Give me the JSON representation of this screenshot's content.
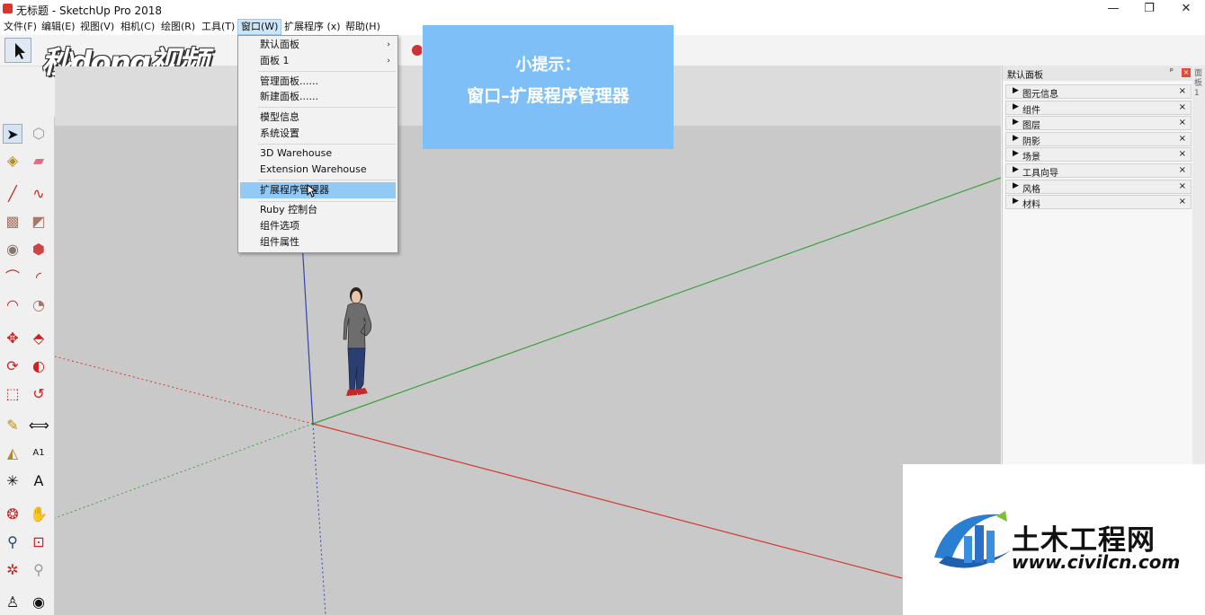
{
  "window": {
    "title": "无标题 - SketchUp Pro 2018",
    "controls": [
      "minimize-icon",
      "restore-icon",
      "close-icon"
    ]
  },
  "menubar": [
    {
      "label": "文件(F)"
    },
    {
      "label": "编辑(E)"
    },
    {
      "label": "视图(V)"
    },
    {
      "label": "相机(C)"
    },
    {
      "label": "绘图(R)"
    },
    {
      "label": "工具(T)"
    },
    {
      "label": "窗口(W)",
      "active": true
    },
    {
      "label": "扩展程序 (x)"
    },
    {
      "label": "帮助(H)"
    }
  ],
  "window_menu": {
    "items": [
      {
        "label": "默认面板",
        "submenu": true
      },
      {
        "label": "面板 1",
        "submenu": true
      },
      {
        "label": "管理面板......"
      },
      {
        "label": "新建面板......"
      },
      {
        "label": "模型信息"
      },
      {
        "label": "系统设置"
      },
      {
        "label": "3D Warehouse"
      },
      {
        "label": "Extension Warehouse"
      },
      {
        "label": "扩展程序管理器",
        "highlighted": true
      },
      {
        "label": "Ruby 控制台"
      },
      {
        "label": "组件选项"
      },
      {
        "label": "组件属性"
      }
    ],
    "submenu_arrow": "›"
  },
  "hint": {
    "line1": "小提示：",
    "line2": "窗口–扩展程序管理器"
  },
  "tray": {
    "title": "默认面板",
    "pin": "ᵖ",
    "close": "×",
    "panels": [
      {
        "label": "图元信息"
      },
      {
        "label": "组件"
      },
      {
        "label": "图层"
      },
      {
        "label": "阴影"
      },
      {
        "label": "场景"
      },
      {
        "label": "工具向导"
      },
      {
        "label": "风格"
      },
      {
        "label": "材料"
      }
    ],
    "side_tab": "面板1"
  },
  "watermarks": {
    "top_left": "秒dong视频",
    "logo_cn": "土木工程网",
    "logo_url": "www.civilcn.com"
  },
  "colors": {
    "hint_bg": "#7fbff7",
    "menu_highlight": "#91c9f7",
    "axis_red": "#d23a2e",
    "axis_green": "#3aa33a",
    "axis_blue": "#3344aa",
    "viewport_ground": "#c9c9c9"
  },
  "left_tools": [
    "select-icon",
    "component-icon",
    "paint-bucket-icon",
    "eraser-icon",
    "pencil-icon",
    "freehand-icon",
    "rectangle-icon",
    "rotated-rectangle-icon",
    "circle-icon",
    "polygon-icon",
    "arc-icon",
    "two-point-arc-icon",
    "three-point-arc-icon",
    "pie-icon",
    "move-icon",
    "push-pull-icon",
    "rotate-icon",
    "follow-me-icon",
    "scale-icon",
    "offset-icon",
    "tape-measure-icon",
    "dimension-icon",
    "protractor-icon",
    "text-icon",
    "axes-icon",
    "3d-text-icon",
    "orbit-icon",
    "pan-icon",
    "zoom-icon",
    "zoom-window-icon",
    "zoom-extents-icon",
    "previous-view-icon",
    "position-camera-icon",
    "look-around-icon"
  ]
}
